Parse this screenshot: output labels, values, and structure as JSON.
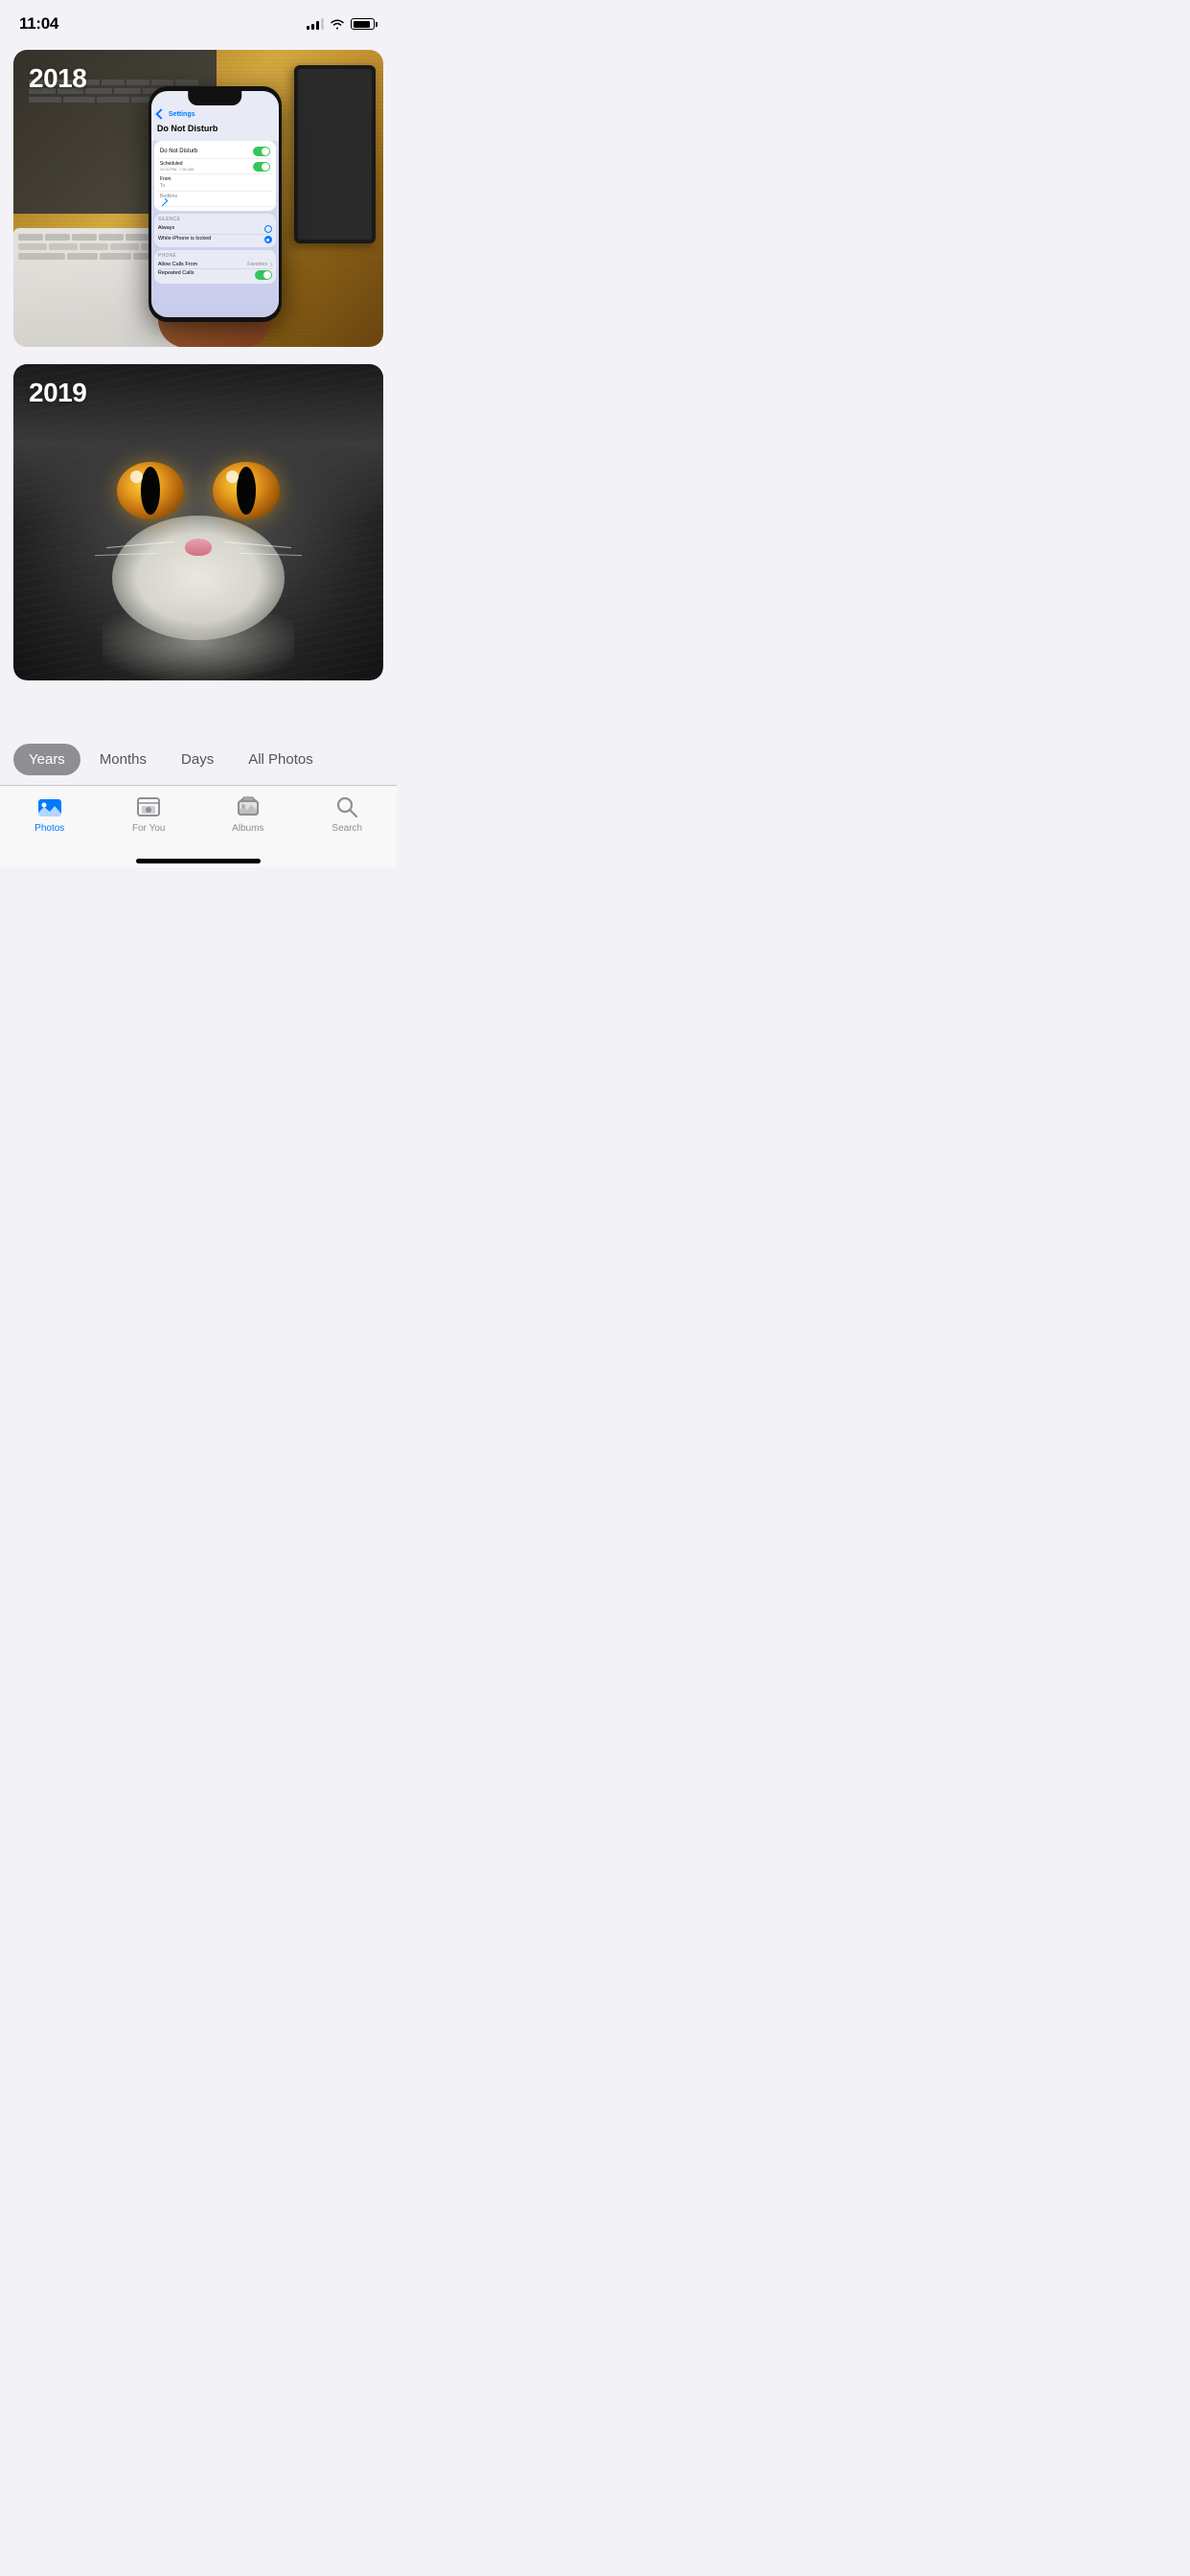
{
  "statusBar": {
    "time": "11:04",
    "battery": 85
  },
  "photos": [
    {
      "year": "2018",
      "type": "phone-settings",
      "altText": "Hand holding iPhone showing Do Not Disturb settings on a cork desk with keyboards"
    },
    {
      "year": "2019",
      "type": "cat",
      "altText": "Close-up of a gray and white cat's face with large orange eyes"
    }
  ],
  "viewSelector": {
    "options": [
      "Years",
      "Months",
      "Days",
      "All Photos"
    ],
    "activeIndex": 0
  },
  "tabBar": {
    "tabs": [
      {
        "label": "Photos",
        "icon": "photos-icon",
        "active": true
      },
      {
        "label": "For You",
        "icon": "for-you-icon",
        "active": false
      },
      {
        "label": "Albums",
        "icon": "albums-icon",
        "active": false
      },
      {
        "label": "Search",
        "icon": "search-icon",
        "active": false
      }
    ]
  }
}
